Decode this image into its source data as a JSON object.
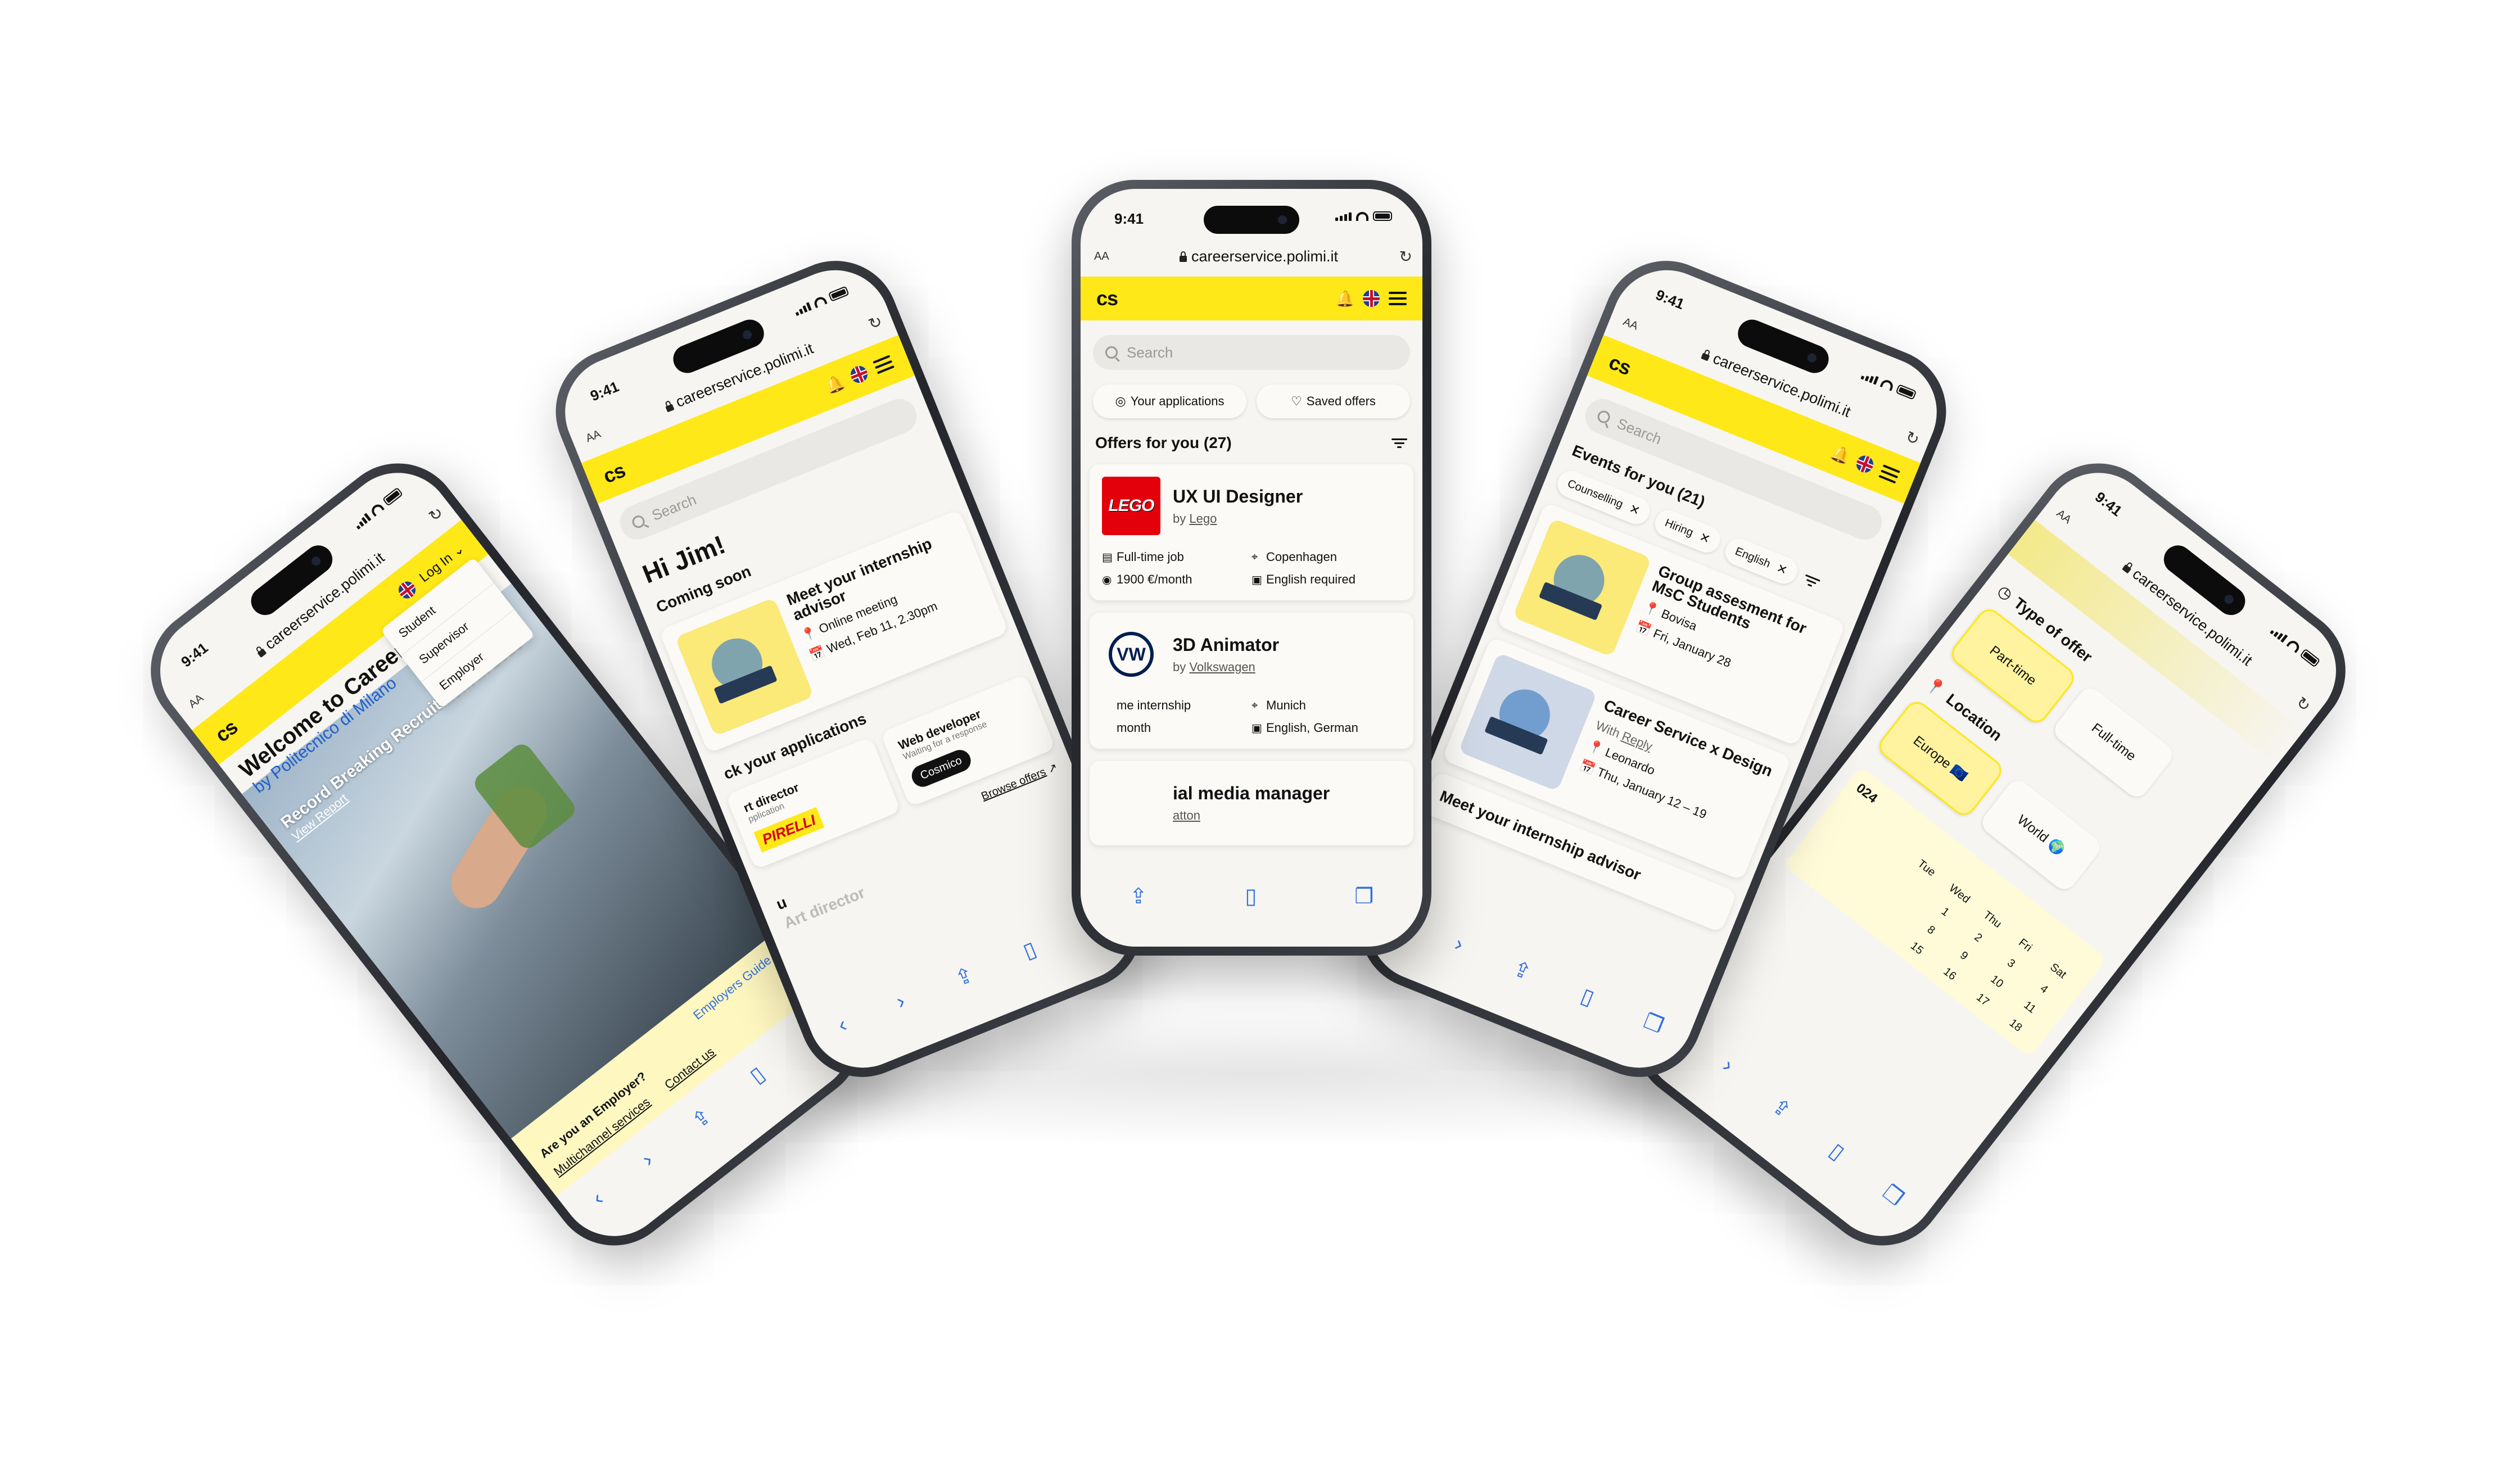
{
  "browser": {
    "time": "9:41",
    "aa": "AA",
    "url": "careerservice.polimi.it"
  },
  "app": {
    "logo": "cs",
    "colors": {
      "accent": "#ffe818",
      "link": "#2f6fe0",
      "background": "#f6f5f1"
    }
  },
  "phone1": {
    "login": "Log In",
    "dropdown": [
      "Student",
      "Supervisor",
      "Employer"
    ],
    "welcome": "Welcome to Career S",
    "by": "by Politecnico di Milano",
    "report_title": "Record Breaking Recruitment in 2023",
    "view_report": "View Report",
    "employers_guide": "Employers Guide",
    "are_you_employer": "Are you an Employer?",
    "multichannel": "Multichannel services",
    "contact": "Contact us"
  },
  "phone2": {
    "search_placeholder": "Search",
    "greeting": "Hi Jim!",
    "coming_soon": "Coming soon",
    "advisor_title": "Meet your internship advisor",
    "advisor_mode": "Online meeting",
    "advisor_date": "Wed, Feb 11, 2.30pm",
    "track": "ck your applications",
    "app1_role": "rt director",
    "app1_status": "pplication",
    "app1_company": "PIRELLI",
    "app2_role": "Web developer",
    "app2_status": "Waiting for a response",
    "app2_company": "Cosmico",
    "browse": "Browse offers",
    "cut_u": "u",
    "cut_art": "Art director"
  },
  "phone3": {
    "search_placeholder": "Search",
    "pill_applications": "Your applications",
    "pill_saved": "Saved offers",
    "offers_heading": "Offers for you (27)",
    "offers": [
      {
        "role": "UX UI Designer",
        "by": "by",
        "company": "Lego",
        "type": "Full-time job",
        "location": "Copenhagen",
        "pay": "1900 €/month",
        "language": "English required"
      },
      {
        "role": "3D Animator",
        "by": "by",
        "company": "Volkswagen",
        "type": "me internship",
        "location": "Munich",
        "pay": "month",
        "language": "English, German"
      },
      {
        "role": "ial media manager",
        "by": "",
        "company": "atton"
      }
    ],
    "lego_logo": "LEGO"
  },
  "phone4": {
    "search_placeholder": "Search",
    "events_heading": "Events for you (21)",
    "chips": [
      "Counselling",
      "Hiring",
      "English"
    ],
    "events": [
      {
        "title": "Group assesment for MsC Students",
        "place": "Bovisa",
        "date": "Fri, January 28"
      },
      {
        "title": "Career Service x Design",
        "with": "With",
        "with_company": "Reply",
        "place": "Leonardo",
        "date": "Thu, January 12 – 19"
      },
      {
        "title": "Meet your internship advisor"
      }
    ]
  },
  "phone5": {
    "type_heading": "Type of offer",
    "types": [
      "Part-time",
      "Full-time"
    ],
    "location_heading": "Location",
    "locations": [
      "Europe 🇪🇺",
      "World 🌍"
    ],
    "year": "024",
    "weekdays": [
      "Tue",
      "Wed",
      "Thu",
      "Fri",
      "Sat"
    ],
    "days": [
      "1",
      "2",
      "3",
      "4",
      "8",
      "9",
      "10",
      "11",
      "15",
      "16",
      "17",
      "18"
    ]
  }
}
